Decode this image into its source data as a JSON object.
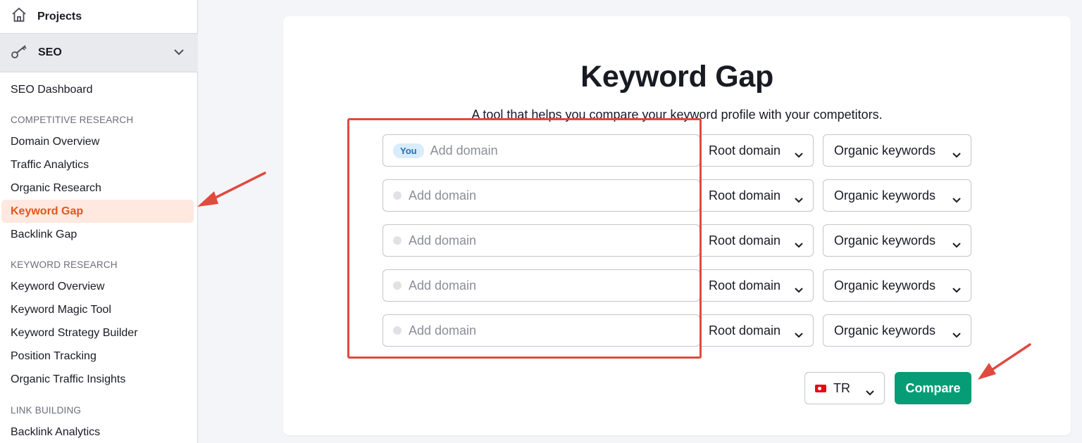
{
  "sidebar": {
    "projects_label": "Projects",
    "seo_label": "SEO",
    "dashboard": "SEO Dashboard",
    "sections": [
      {
        "title": "COMPETITIVE RESEARCH",
        "items": [
          "Domain Overview",
          "Traffic Analytics",
          "Organic Research",
          "Keyword Gap",
          "Backlink Gap"
        ]
      },
      {
        "title": "KEYWORD RESEARCH",
        "items": [
          "Keyword Overview",
          "Keyword Magic Tool",
          "Keyword Strategy Builder",
          "Position Tracking",
          "Organic Traffic Insights"
        ]
      },
      {
        "title": "LINK BUILDING",
        "items": [
          "Backlink Analytics"
        ]
      }
    ],
    "active_item": "Keyword Gap"
  },
  "main": {
    "title": "Keyword Gap",
    "subtitle": "A tool that helps you compare your keyword profile with your competitors.",
    "you_badge": "You",
    "rows": [
      {
        "placeholder": "Add domain",
        "scope": "Root domain",
        "type": "Organic keywords"
      },
      {
        "placeholder": "Add domain",
        "scope": "Root domain",
        "type": "Organic keywords"
      },
      {
        "placeholder": "Add domain",
        "scope": "Root domain",
        "type": "Organic keywords"
      },
      {
        "placeholder": "Add domain",
        "scope": "Root domain",
        "type": "Organic keywords"
      },
      {
        "placeholder": "Add domain",
        "scope": "Root domain",
        "type": "Organic keywords"
      }
    ],
    "country": "TR",
    "compare_label": "Compare"
  },
  "colors": {
    "accent_active": "#e0561f",
    "compare_green": "#069c76",
    "annotation_red": "#e04a3f"
  }
}
